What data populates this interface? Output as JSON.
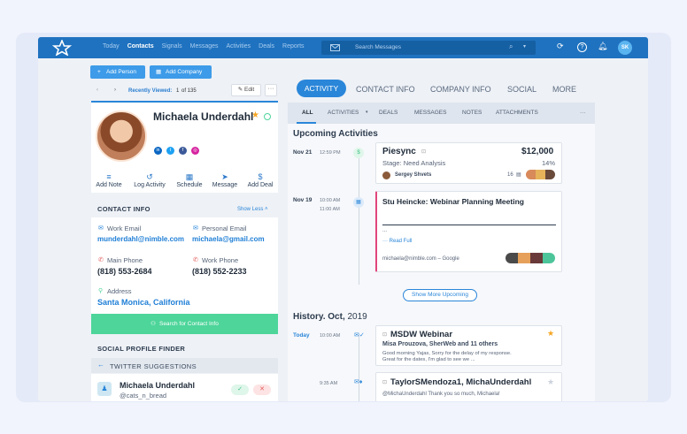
{
  "topbar": {
    "nav": [
      "Today",
      "Contacts",
      "Signals",
      "Messages",
      "Activities",
      "Deals",
      "Reports"
    ],
    "active_nav": "Contacts",
    "search_placeholder": "Search Messages",
    "avatar": "SK"
  },
  "toolbar": {
    "add_person": "Add Person",
    "add_company": "Add Company",
    "edit": "Edit",
    "more": "···"
  },
  "pager": {
    "label": "Recently Viewed:",
    "position": "1",
    "of": "of 135"
  },
  "profile": {
    "name": "Michaela Underdahl",
    "actions": [
      "Add Note",
      "Log Activity",
      "Schedule",
      "Message",
      "Add Deal"
    ]
  },
  "contact_info": {
    "title": "CONTACT INFO",
    "show_less": "Show Less",
    "work_email_label": "Work Email",
    "work_email": "munderdahl@nimble.com",
    "personal_email_label": "Personal Email",
    "personal_email": "michaela@gmail.com",
    "main_phone_label": "Main Phone",
    "main_phone": "(818) 553-2684",
    "work_phone_label": "Work Phone",
    "work_phone": "(818) 552-2233",
    "address_label": "Address",
    "address": "Santa Monica, California",
    "search_button": "Search for Contact Info"
  },
  "social_finder": {
    "title": "SOCIAL PROFILE FINDER",
    "twitter_title": "TWITTER SUGGESTIONS",
    "suggestion_name": "Michaela Underdahl",
    "suggestion_handle": "@cats_n_bread"
  },
  "tabs": [
    "ACTIVITY",
    "CONTACT INFO",
    "COMPANY INFO",
    "SOCIAL",
    "MORE"
  ],
  "subtabs": [
    "ALL",
    "ACTIVITIES",
    "DEALS",
    "MESSAGES",
    "NOTES",
    "ATTACHMENTS",
    "···"
  ],
  "upcoming": {
    "title": "Upcoming Activities",
    "deal": {
      "date": "Nov 21",
      "time": "12:59 PM",
      "name": "Piesync",
      "amount": "$12,000",
      "stage": "Stage: Need Analysis",
      "prob": "14%",
      "owner": "Sergey Shvets",
      "count": "16"
    },
    "meeting": {
      "date": "Nov 19",
      "time1": "10:00 AM",
      "time2": "11:00 AM",
      "title": "Stu Heincke: Webinar Planning Meeting",
      "read_full": "Read Full",
      "source": "michaela@nimble.com – Google"
    },
    "show_more": "Show More Upcoming"
  },
  "history": {
    "title": "History. Oct,",
    "year": "2019",
    "item1": {
      "day": "Today",
      "time": "10:00 AM",
      "title": "MSDW Webinar",
      "subtitle": "Misa Prouzova, SherWeb and 11 others",
      "body": "Good morning Yajas, Sorry for the delay of my response. Great for the dates, I'm glad to see we ..."
    },
    "item2": {
      "time": "9:35 AM",
      "title": "TaylorSMendoza1, MichaUnderdahl",
      "body": "@MichaUnderdahl Thank you so much, Michaela!"
    }
  }
}
